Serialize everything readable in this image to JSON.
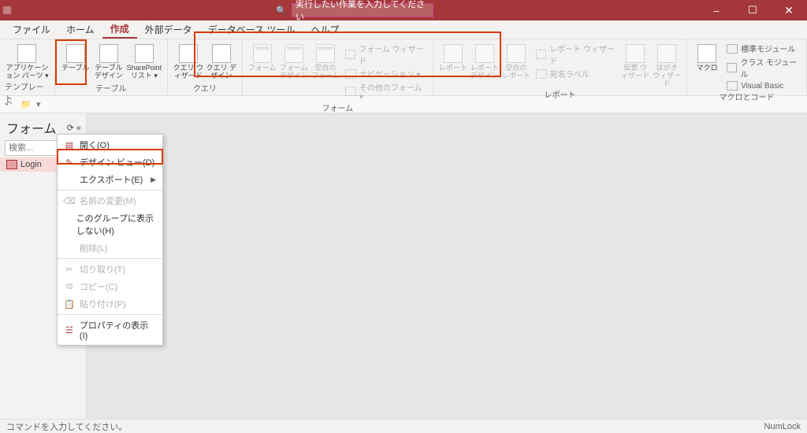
{
  "titlebar": {
    "search_placeholder": "実行したい作業を入力してください",
    "search_icon": "検索",
    "min": "–",
    "max": "☐",
    "close": "✕"
  },
  "tabs": {
    "items": [
      {
        "label": "ファイル"
      },
      {
        "label": "ホーム"
      },
      {
        "label": "作成"
      },
      {
        "label": "外部データ"
      },
      {
        "label": "データベース ツール"
      },
      {
        "label": "ヘルプ"
      }
    ],
    "active_index": 2
  },
  "ribbon": {
    "groups": [
      {
        "label": "テンプレート",
        "big": [
          {
            "t": "アプリケーション\nパーツ ▾"
          }
        ]
      },
      {
        "label": "テーブル",
        "big": [
          {
            "t": "テーブル"
          },
          {
            "t": "テーブル\nデザイン"
          },
          {
            "t": "SharePoint\nリスト ▾"
          }
        ]
      },
      {
        "label": "クエリ",
        "big": [
          {
            "t": "クエリ\nウィザード"
          },
          {
            "t": "クエリ\nデザイン"
          }
        ]
      },
      {
        "label": "フォーム",
        "dim": true,
        "big": [
          {
            "t": "フォーム"
          },
          {
            "t": "フォーム\nデザイン"
          },
          {
            "t": "空白の\nフォーム"
          }
        ],
        "small": [
          "フォーム ウィザード",
          "ナビゲーション ▾",
          "その他のフォーム ▾"
        ]
      },
      {
        "label": "レポート",
        "dim": true,
        "big": [
          {
            "t": "レポート"
          },
          {
            "t": "レポート\nデザイン"
          },
          {
            "t": "空白の\nレポート"
          }
        ],
        "small": [
          "レポート ウィザード",
          "宛名ラベル"
        ],
        "big2": [
          {
            "t": "伝票\nウィザード"
          },
          {
            "t": "はがき\nウィザード"
          }
        ]
      },
      {
        "label": "マクロとコード",
        "big": [
          {
            "t": "マクロ"
          }
        ],
        "small": [
          "標準モジュール",
          "クラス モジュール",
          "Visual Basic"
        ]
      }
    ]
  },
  "sidepane": {
    "title": "フォーム",
    "refresh": "⟳",
    "collapse": "«",
    "search_placeholder": "検索...",
    "items": [
      {
        "label": "Login"
      }
    ]
  },
  "context_menu": {
    "items": [
      {
        "icon": "▤",
        "label": "開く(O)",
        "enabled": true
      },
      {
        "icon": "✎",
        "label": "デザイン ビュー(D)",
        "enabled": true,
        "highlight": true
      },
      {
        "icon": "",
        "label": "エクスポート(E)",
        "enabled": true,
        "submenu": true
      },
      {
        "sep": true
      },
      {
        "icon": "⌫",
        "label": "名前の変更(M)",
        "enabled": false
      },
      {
        "icon": "",
        "label": "このグループに表示しない(H)",
        "enabled": true
      },
      {
        "icon": "",
        "label": "削除(L)",
        "enabled": false
      },
      {
        "sep": true
      },
      {
        "icon": "✂",
        "label": "切り取り(T)",
        "enabled": false
      },
      {
        "icon": "⧉",
        "label": "コピー(C)",
        "enabled": false
      },
      {
        "icon": "📋",
        "label": "貼り付け(P)",
        "enabled": false
      },
      {
        "sep": true
      },
      {
        "icon": "☱",
        "label": "プロパティの表示(I)",
        "enabled": true
      }
    ]
  },
  "status": {
    "left": "コマンドを入力してください。",
    "right": "NumLock"
  }
}
